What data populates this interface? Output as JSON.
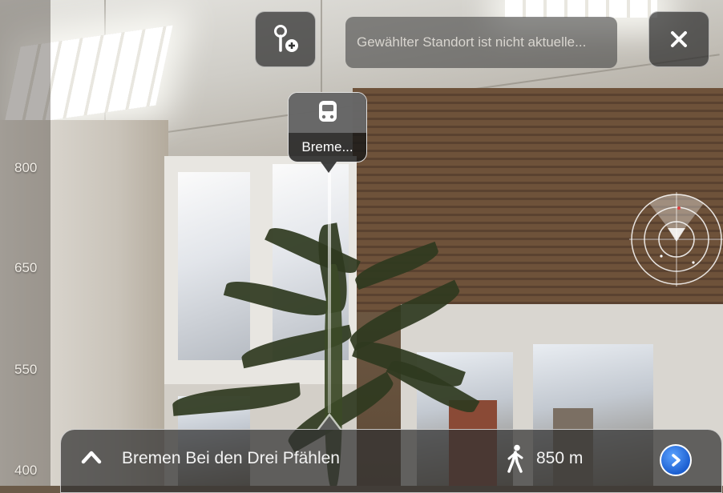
{
  "altitude_scale": {
    "labels": [
      "800",
      "650",
      "550",
      "400"
    ]
  },
  "toolbar": {
    "add_location_icon": "pin-plus-icon",
    "location_field": "Gewählter Standort ist nicht aktuelle...",
    "close_icon": "close-icon"
  },
  "poi_marker": {
    "icon": "train-icon",
    "label": "Breme..."
  },
  "info_bar": {
    "expand_icon": "chevron-up-icon",
    "poi_name": "Bremen Bei den Drei Pfählen",
    "walk_icon": "walking-person-icon",
    "distance": "850 m",
    "detail_icon": "chevron-right-circle-icon"
  },
  "colors": {
    "detail_button": "#1c5fd0",
    "overlay": "#323232"
  }
}
